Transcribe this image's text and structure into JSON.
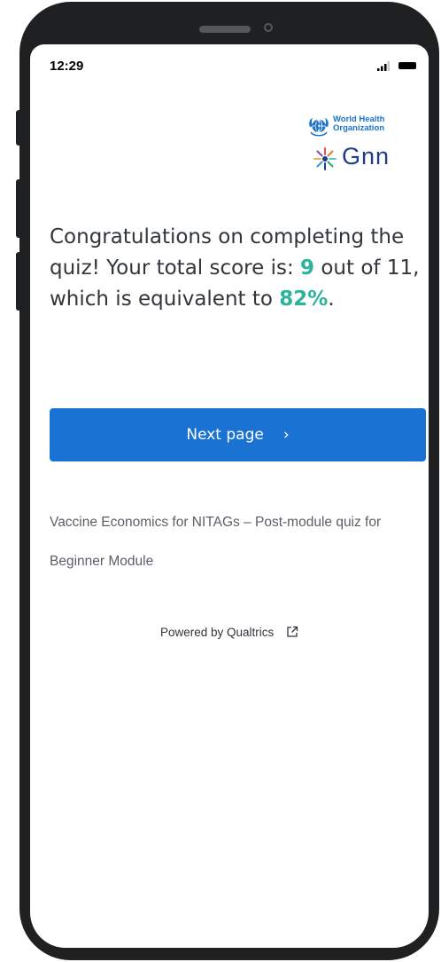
{
  "status_bar": {
    "time": "12:29"
  },
  "logos": {
    "who_line1": "World Health",
    "who_line2": "Organization",
    "gnn": "Gnn"
  },
  "message": {
    "line_part1": "Congratulations on completing the quiz! Your total score is: ",
    "score": "9",
    "line_part2": " out of 11,",
    "line_part3": "which is equivalent to ",
    "percent": "82%",
    "line_part4": "."
  },
  "next_button": {
    "label": "Next page",
    "chevron": "›"
  },
  "survey": {
    "title": "Vaccine Economics for NITAGs – Post-module quiz for Beginner Module"
  },
  "footer": {
    "powered_by": "Powered by Qualtrics"
  },
  "colors": {
    "accent_button": "#1a73d3",
    "score_green": "#2bb39b"
  }
}
